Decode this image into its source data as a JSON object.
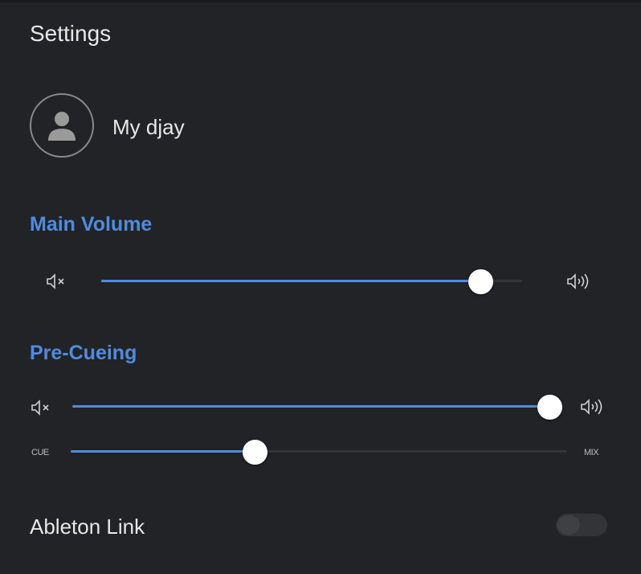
{
  "settings": {
    "title": "Settings"
  },
  "user": {
    "name": "My djay",
    "avatar_icon": "user-avatar-icon"
  },
  "main_volume": {
    "label": "Main Volume",
    "level": 0.9,
    "min_icon": "speaker-mute-icon",
    "max_icon": "speaker-loud-icon"
  },
  "pre_cueing": {
    "label": "Pre-Cueing",
    "volume_level": 0.99,
    "min_icon": "speaker-mute-icon",
    "max_icon": "speaker-loud-icon",
    "cue_mix": {
      "left_label": "CUE",
      "right_label": "MIX",
      "level": 0.37
    }
  },
  "ableton_link": {
    "label": "Ableton Link",
    "enabled": false
  },
  "colors": {
    "accent": "#4f8be0",
    "background": "#222326"
  }
}
